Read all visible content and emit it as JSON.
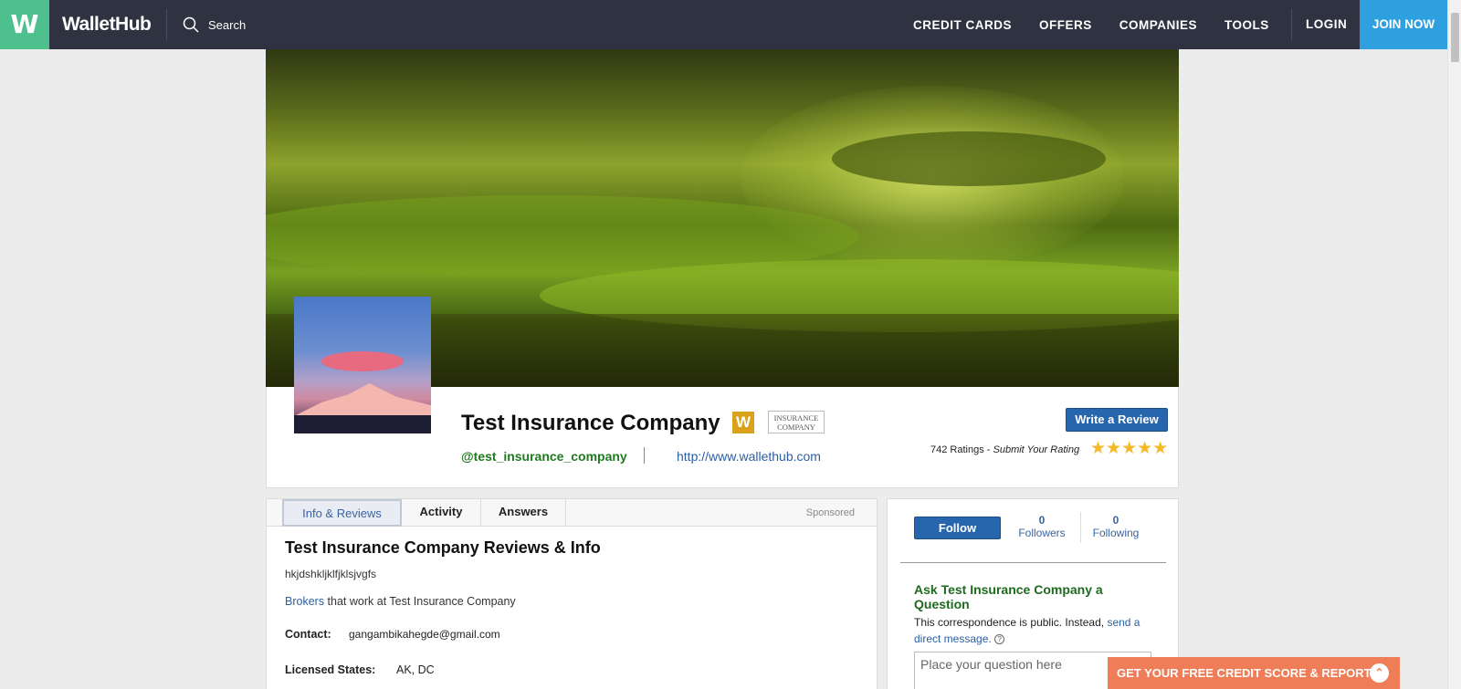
{
  "nav": {
    "logo_letter": "W",
    "brand": "WalletHub",
    "search_label": "Search",
    "links": [
      "CREDIT CARDS",
      "OFFERS",
      "COMPANIES",
      "TOOLS"
    ],
    "login": "LOGIN",
    "join": "JOIN NOW"
  },
  "profile": {
    "company_name": "Test Insurance Company",
    "badge_letter": "W",
    "category_badge_line1": "INSURANCE",
    "category_badge_line2": "COMPANY",
    "handle": "@test_insurance_company",
    "website": "http://www.wallethub.com",
    "write_review": "Write a Review",
    "ratings_count": "742 Ratings",
    "ratings_sep": " - ",
    "submit_rating": "Submit Your Rating",
    "stars": "★★★★★"
  },
  "tabs": {
    "items": [
      "Info & Reviews",
      "Activity",
      "Answers"
    ],
    "sponsored": "Sponsored"
  },
  "info": {
    "title": "Test Insurance Company Reviews & Info",
    "description": "hkjdshkljklfjklsjvgfs",
    "brokers_link": "Brokers",
    "brokers_text": " that work at Test Insurance Company",
    "contact_label": "Contact:",
    "contact_value": "gangambikahegde@gmail.com",
    "licensed_label": "Licensed States:",
    "licensed_value": "AK, DC"
  },
  "sidebar": {
    "follow": "Follow",
    "followers_count": "0",
    "followers_label": "Followers",
    "following_count": "0",
    "following_label": "Following",
    "ask_title": "Ask Test Insurance Company a Question",
    "ask_desc": "This correspondence is public. Instead, ",
    "send_message": "send a direct message.",
    "help": "?",
    "question_placeholder": "Place your question here"
  },
  "credit_bar": {
    "label": "GET YOUR FREE CREDIT SCORE & REPORT",
    "icon": "chevron-up-icon"
  },
  "colors": {
    "nav_bg": "#2f3240",
    "logo_green": "#4dc08e",
    "join_blue": "#2ea0e0",
    "button_blue": "#2766ad",
    "handle_green": "#1e7a1e",
    "star_gold": "#f5b928",
    "credit_orange": "#ef7d58"
  }
}
